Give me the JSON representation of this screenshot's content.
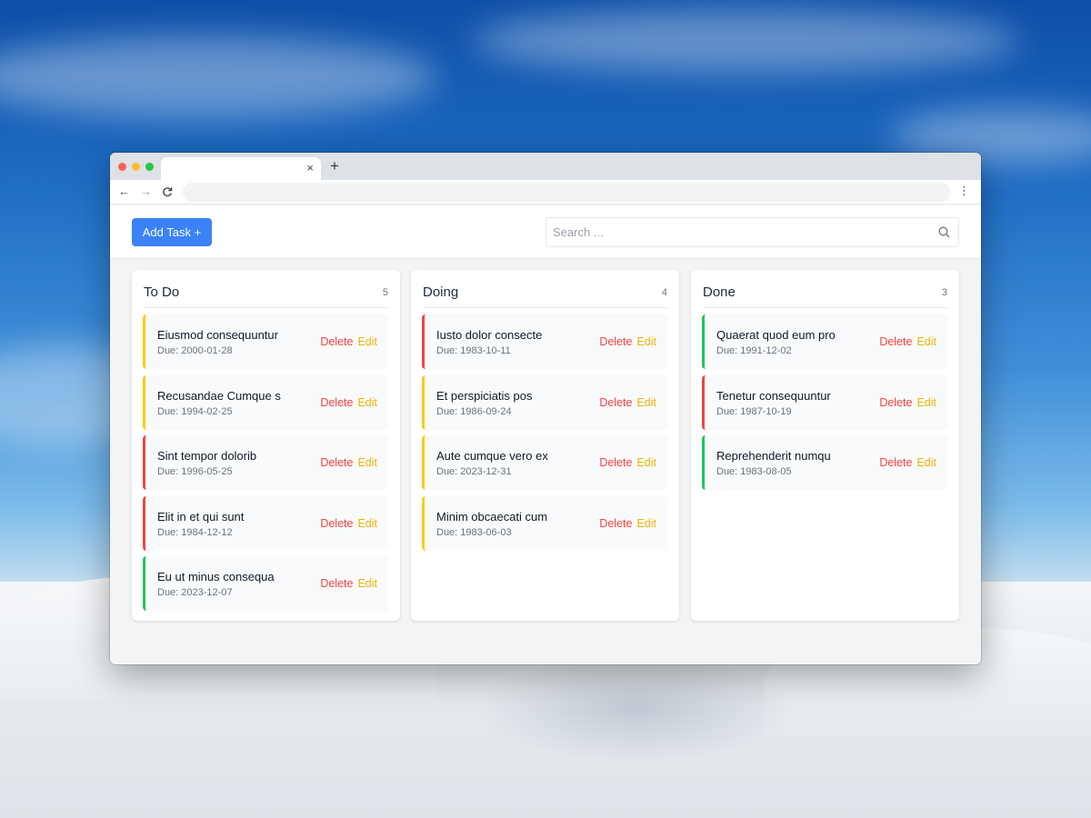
{
  "app": {
    "add_task_label": "Add Task +",
    "search_placeholder": "Search ...",
    "search_value": ""
  },
  "browser": {
    "tab_title": "",
    "url": "",
    "close_tab_glyph": "×",
    "new_tab_glyph": "+",
    "back_glyph": "←",
    "forward_glyph": "→",
    "reload_glyph": "C",
    "menu_glyph": "⋮"
  },
  "actions": {
    "delete_label": "Delete",
    "edit_label": "Edit"
  },
  "colors": {
    "accent": "#3b82f6",
    "priority_high": "#ef4444",
    "priority_medium": "#facc15",
    "priority_low": "#22c55e"
  },
  "columns": [
    {
      "title": "To Do",
      "count": "5",
      "cards": [
        {
          "title": "Eiusmod consequuntur",
          "due": "Due: 2000-01-28",
          "priority": "yellow"
        },
        {
          "title": "Recusandae Cumque s",
          "due": "Due: 1994-02-25",
          "priority": "yellow"
        },
        {
          "title": "Sint tempor dolorib",
          "due": "Due: 1996-05-25",
          "priority": "red"
        },
        {
          "title": "Elit in et qui sunt",
          "due": "Due: 1984-12-12",
          "priority": "red"
        },
        {
          "title": "Eu ut minus consequa",
          "due": "Due: 2023-12-07",
          "priority": "green"
        }
      ]
    },
    {
      "title": "Doing",
      "count": "4",
      "cards": [
        {
          "title": "Iusto dolor consecte",
          "due": "Due: 1983-10-11",
          "priority": "red"
        },
        {
          "title": "Et perspiciatis pos",
          "due": "Due: 1986-09-24",
          "priority": "yellow"
        },
        {
          "title": "Aute cumque vero ex",
          "due": "Due: 2023-12-31",
          "priority": "yellow"
        },
        {
          "title": "Minim obcaecati cum",
          "due": "Due: 1983-06-03",
          "priority": "yellow"
        }
      ]
    },
    {
      "title": "Done",
      "count": "3",
      "cards": [
        {
          "title": "Quaerat quod eum pro",
          "due": "Due: 1991-12-02",
          "priority": "green"
        },
        {
          "title": "Tenetur consequuntur",
          "due": "Due: 1987-10-19",
          "priority": "red"
        },
        {
          "title": "Reprehenderit numqu",
          "due": "Due: 1983-08-05",
          "priority": "green"
        }
      ]
    }
  ]
}
